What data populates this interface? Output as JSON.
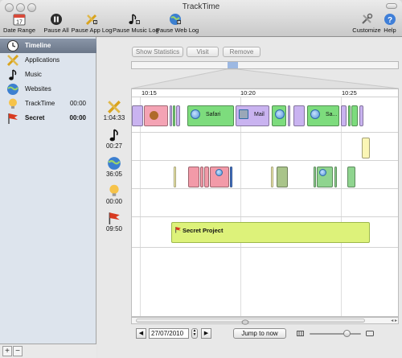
{
  "window": {
    "title": "TrackTime"
  },
  "toolbar": {
    "date_range": "Date Range",
    "calendar_day": "17",
    "pause_all": "Pause All",
    "pause_app_log": "Pause App Log",
    "pause_music_log": "Pause Music Log",
    "pause_web_log": "Pause Web Log",
    "customize": "Customize",
    "help": "Help"
  },
  "sidebar": {
    "items": [
      {
        "label": "Timeline",
        "time": "",
        "icon": "clock-icon"
      },
      {
        "label": "Applications",
        "time": "",
        "icon": "applications-icon"
      },
      {
        "label": "Music",
        "time": "",
        "icon": "music-note-icon"
      },
      {
        "label": "Websites",
        "time": "",
        "icon": "globe-icon"
      },
      {
        "label": "TrackTime",
        "time": "00:00",
        "icon": "lightbulb-icon"
      },
      {
        "label": "Secret",
        "time": "00:00",
        "icon": "flag-icon"
      }
    ],
    "add": "+",
    "remove": "−"
  },
  "main": {
    "show_statistics": "Show Statistics",
    "visit": "Visit",
    "remove": "Remove",
    "hours": [
      "10:15",
      "10:20",
      "10:25"
    ],
    "rows": [
      {
        "icon": "applications-icon",
        "time": "1:04:33"
      },
      {
        "icon": "music-note-icon",
        "time": "00:27"
      },
      {
        "icon": "globe-icon",
        "time": "36:05"
      },
      {
        "icon": "lightbulb-icon",
        "time": "00:00"
      },
      {
        "icon": "flag-icon",
        "time": "09:50"
      }
    ],
    "app_labels": {
      "safari": "Safari",
      "mail": "Mail",
      "sa": "Sa..."
    },
    "secret_project": "Secret Project",
    "date": "27/07/2010",
    "prev": "◀",
    "next": "▶",
    "jump_to_now": "Jump to now",
    "scroll_arrows": "◂ ▸"
  },
  "colors": {
    "app_green": "#7ddc7d",
    "app_purple": "#c9b3f0",
    "app_pink": "#f4a3b4",
    "web_green": "#8fd48f",
    "web_pink": "#f29aa8",
    "music_yellow": "#fbf6b6",
    "secret_lime": "#ddf27a"
  }
}
